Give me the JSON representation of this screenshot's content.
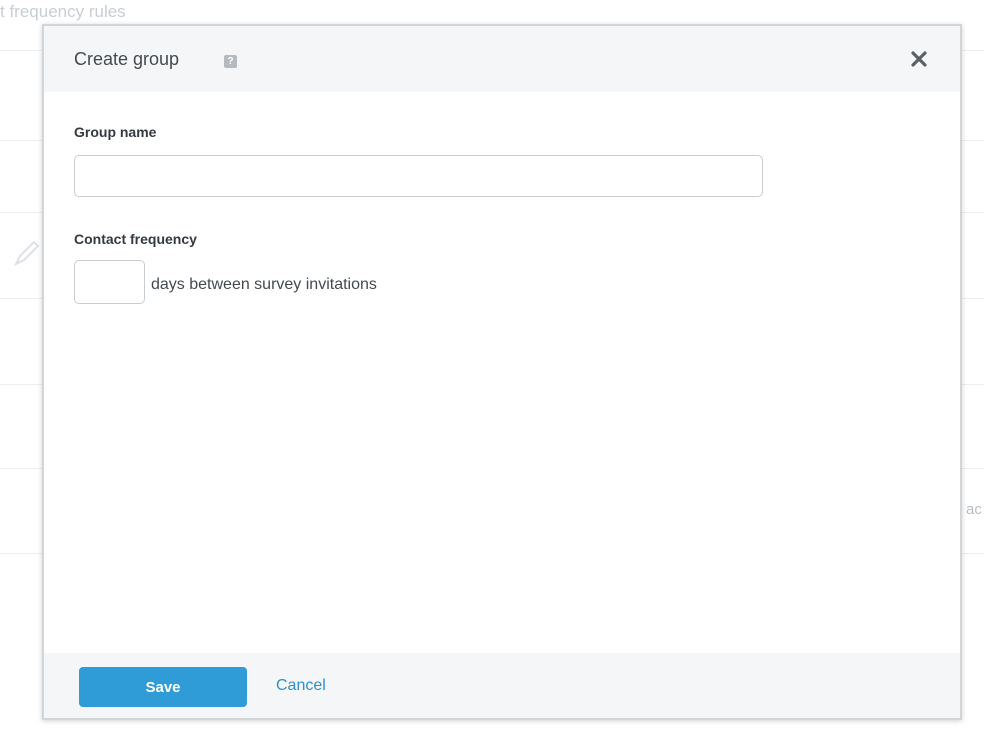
{
  "background": {
    "title": "t frequency rules",
    "right_text": "ac"
  },
  "modal": {
    "title": "Create group",
    "help_icon": "question-icon",
    "close_icon": "close-icon",
    "group_name": {
      "label": "Group name",
      "value": "",
      "placeholder": ""
    },
    "contact_frequency": {
      "label": "Contact frequency",
      "value": "",
      "suffix": "days between survey invitations"
    },
    "footer": {
      "save_label": "Save",
      "cancel_label": "Cancel"
    }
  },
  "colors": {
    "accent": "#2f9bd7",
    "link": "#2f8fd0",
    "header_bg": "#f5f6f7"
  }
}
